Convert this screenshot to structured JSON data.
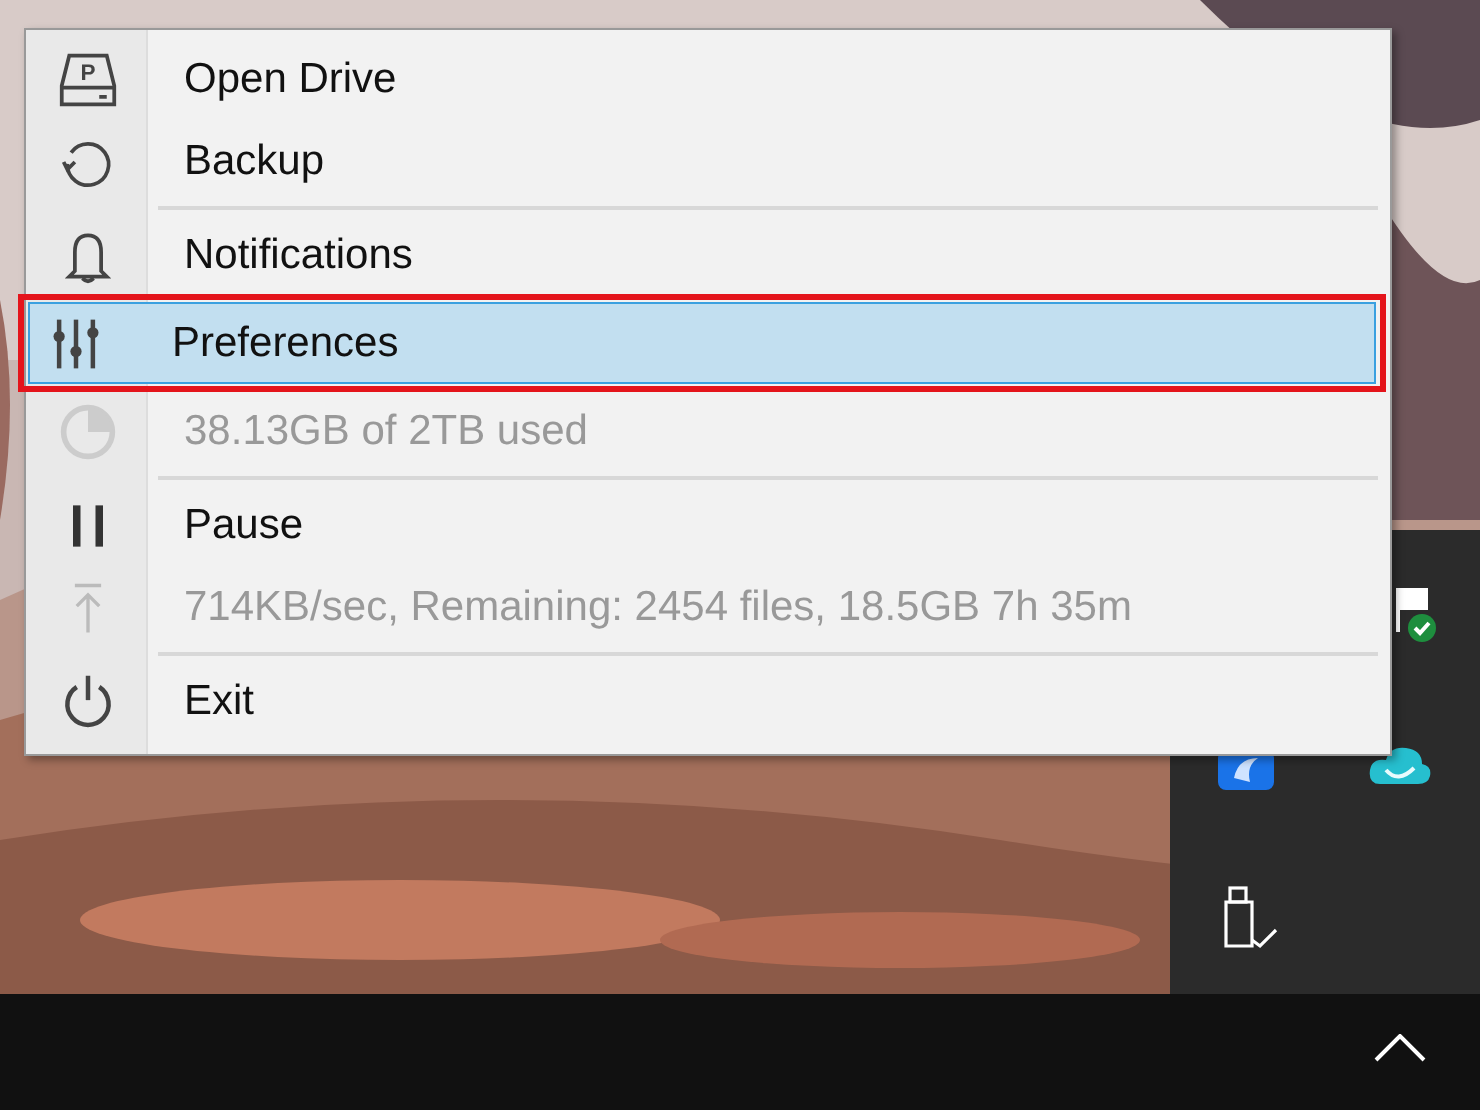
{
  "menu": {
    "items": [
      {
        "kind": "item",
        "label": "Open Drive",
        "icon_letter": "P",
        "disabled": false,
        "selected": false,
        "outlined": false
      },
      {
        "kind": "item",
        "label": "Backup",
        "disabled": false,
        "selected": false,
        "outlined": false
      },
      {
        "kind": "separator"
      },
      {
        "kind": "item",
        "label": "Notifications",
        "disabled": false,
        "selected": false,
        "outlined": false
      },
      {
        "kind": "item",
        "label": "Preferences",
        "disabled": false,
        "selected": true,
        "outlined": true
      },
      {
        "kind": "item",
        "label": "38.13GB of 2TB used",
        "disabled": true,
        "selected": false,
        "outlined": false
      },
      {
        "kind": "separator"
      },
      {
        "kind": "item",
        "label": "Pause",
        "disabled": false,
        "selected": false,
        "outlined": false
      },
      {
        "kind": "item",
        "label": "714KB/sec, Remaining: 2454 files, 18.5GB 7h 35m",
        "disabled": true,
        "selected": false,
        "outlined": false
      },
      {
        "kind": "separator"
      },
      {
        "kind": "item",
        "label": "Exit",
        "disabled": false,
        "selected": false,
        "outlined": false
      }
    ]
  }
}
